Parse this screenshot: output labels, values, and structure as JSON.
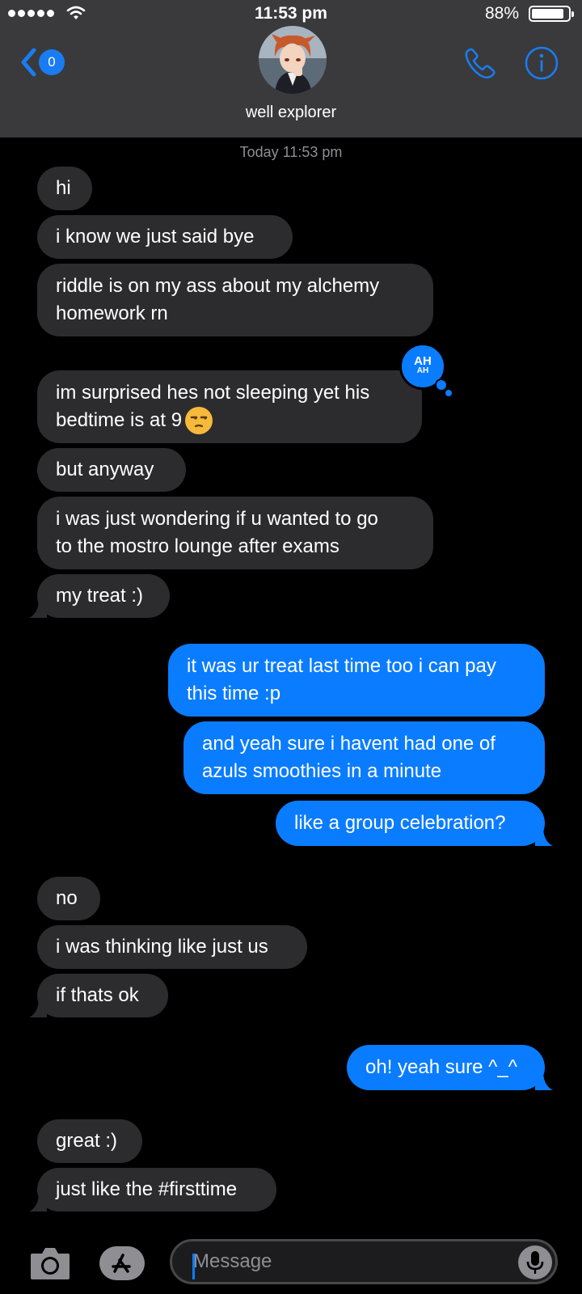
{
  "status_bar": {
    "time": "11:53 pm",
    "battery": "88%",
    "battery_level": 0.88
  },
  "header": {
    "back_badge": "0",
    "contact_name": "well explorer"
  },
  "thread": {
    "timestamp": "Today 11:53 pm",
    "messages": [
      {
        "from": "them",
        "text": "hi"
      },
      {
        "from": "them",
        "text": "i know we just said bye"
      },
      {
        "from": "them",
        "line1": "riddle is on my ass about my alchemy",
        "line2": "homework rn"
      },
      {
        "from": "them",
        "line1": "im surprised hes not sleeping yet his",
        "line2": "bedtime is at 9",
        "emoji": "unamused-face"
      },
      {
        "from": "them",
        "text": "but anyway"
      },
      {
        "from": "them",
        "line1": "i was just wondering if u wanted to go",
        "line2": "to the mostro lounge after exams"
      },
      {
        "from": "them",
        "text": "my treat :)"
      },
      {
        "from": "me",
        "line1": "it was ur treat last time too i can pay",
        "line2": "this time :p"
      },
      {
        "from": "me",
        "line1": "and yeah sure i havent had one of",
        "line2": "azuls smoothies in a minute"
      },
      {
        "from": "me",
        "text": "like a group celebration?"
      },
      {
        "from": "them",
        "text": "no"
      },
      {
        "from": "them",
        "text": "i was thinking like just us"
      },
      {
        "from": "them",
        "text": "if thats ok"
      },
      {
        "from": "me",
        "text": "oh! yeah sure ^_^"
      },
      {
        "from": "them",
        "text": "great :)"
      },
      {
        "from": "them",
        "text": "just like the #firsttime"
      }
    ],
    "reaction": {
      "top": "AH",
      "bottom": "AH"
    }
  },
  "input": {
    "placeholder": "Message"
  },
  "colors": {
    "accent": "#0a7cff",
    "incoming": "#2c2c2e",
    "header_bg": "#3a3a3c"
  },
  "icons": [
    "wifi-icon",
    "battery-icon",
    "back-chevron-icon",
    "phone-icon",
    "info-icon",
    "camera-icon",
    "app-store-icon",
    "microphone-icon"
  ]
}
